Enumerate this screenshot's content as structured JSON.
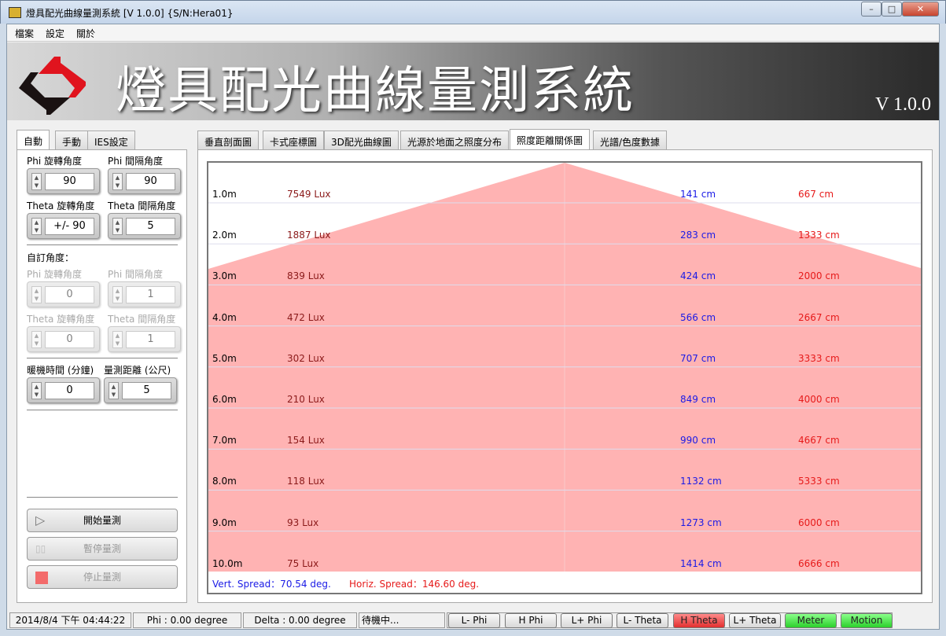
{
  "window": {
    "title": "燈具配光曲線量測系統 [V 1.0.0] {S/N:Hera01}"
  },
  "menu": [
    "檔案",
    "設定",
    "關於"
  ],
  "banner": {
    "title": "燈具配光曲線量測系統",
    "version": "V 1.0.0"
  },
  "left_tabs": [
    "自動",
    "手動",
    "IES設定"
  ],
  "auto": {
    "phi_rot_label": "Phi 旋轉角度",
    "phi_rot": "90",
    "phi_int_label": "Phi 間隔角度",
    "phi_int": "90",
    "theta_rot_label": "Theta 旋轉角度",
    "theta_rot": "+/- 90",
    "theta_int_label": "Theta 間隔角度",
    "theta_int": "5",
    "custom_label": "自訂角度：",
    "c_phi_rot_label": "Phi 旋轉角度",
    "c_phi_rot": "0",
    "c_phi_int_label": "Phi 間隔角度",
    "c_phi_int": "1",
    "c_theta_rot_label": "Theta 旋轉角度",
    "c_theta_rot": "0",
    "c_theta_int_label": "Theta 間隔角度",
    "c_theta_int": "1",
    "warmup_label": "暖機時間 (分鐘)",
    "warmup": "0",
    "distance_label": "量測距離 (公尺)",
    "distance": "5",
    "start": "開始量測",
    "pause": "暫停量測",
    "stop": "停止量測"
  },
  "right_tabs": [
    "垂直剖面圖",
    "卡式座標圖",
    "3D配光曲線圖",
    "光源於地面之照度分布",
    "照度距離關係圖",
    "光譜/色度數據"
  ],
  "active_right_tab": 4,
  "chart": {
    "rows": [
      {
        "d": "1.0m",
        "lux": "7549 Lux",
        "v": "141 cm",
        "h": "667 cm"
      },
      {
        "d": "2.0m",
        "lux": "1887 Lux",
        "v": "283 cm",
        "h": "1333 cm"
      },
      {
        "d": "3.0m",
        "lux": "839 Lux",
        "v": "424 cm",
        "h": "2000 cm"
      },
      {
        "d": "4.0m",
        "lux": "472 Lux",
        "v": "566 cm",
        "h": "2667 cm"
      },
      {
        "d": "5.0m",
        "lux": "302 Lux",
        "v": "707 cm",
        "h": "3333 cm"
      },
      {
        "d": "6.0m",
        "lux": "210 Lux",
        "v": "849 cm",
        "h": "4000 cm"
      },
      {
        "d": "7.0m",
        "lux": "154 Lux",
        "v": "990 cm",
        "h": "4667 cm"
      },
      {
        "d": "8.0m",
        "lux": "118 Lux",
        "v": "1132 cm",
        "h": "5333 cm"
      },
      {
        "d": "9.0m",
        "lux": "93 Lux",
        "v": "1273 cm",
        "h": "6000 cm"
      },
      {
        "d": "10.0m",
        "lux": "75 Lux",
        "v": "1414 cm",
        "h": "6666 cm"
      }
    ],
    "vert_spread": "Vert. Spread：70.54 deg.",
    "horiz_spread": "Horiz. Spread：146.60 deg.",
    "colors": {
      "fill": "#ffb3b3",
      "vert": "#1a1ae6",
      "horiz": "#e61a1a",
      "lux": "#8b1a1a"
    }
  },
  "status": {
    "time": "2014/8/4 下午 04:44:22",
    "phi": "Phi : 0.00 degree",
    "delta": "Delta : 0.00 degree",
    "state": "待機中...",
    "buttons": [
      {
        "label": "L- Phi",
        "c": ""
      },
      {
        "label": "H Phi",
        "c": ""
      },
      {
        "label": "L+ Phi",
        "c": ""
      },
      {
        "label": "L- Theta",
        "c": ""
      },
      {
        "label": "H Theta",
        "c": "red"
      },
      {
        "label": "L+ Theta",
        "c": ""
      },
      {
        "label": "Meter",
        "c": "green"
      },
      {
        "label": "Motion",
        "c": "green"
      }
    ]
  }
}
